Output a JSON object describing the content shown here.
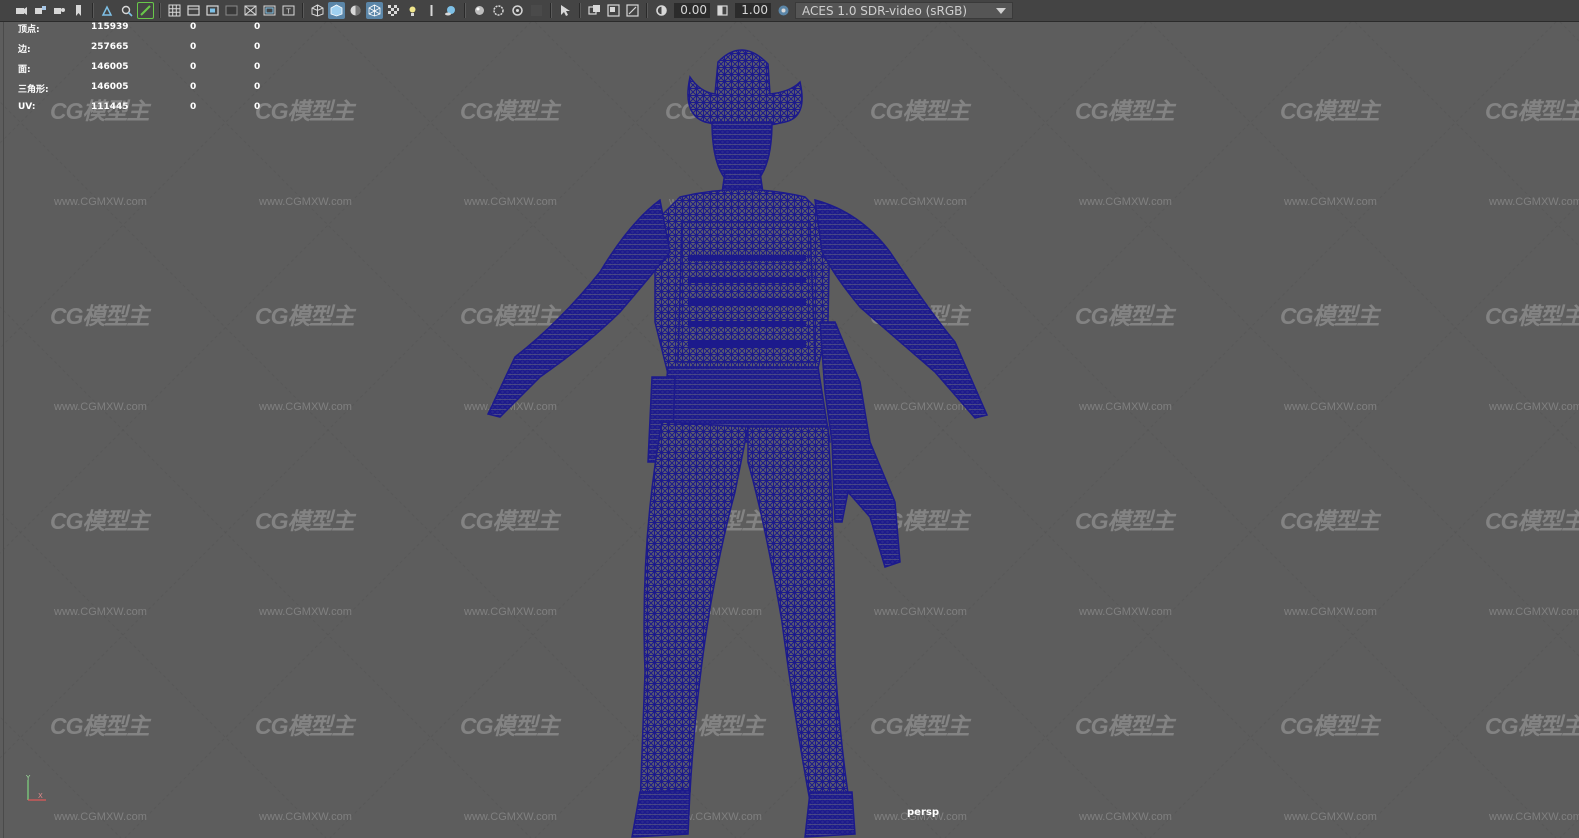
{
  "toolbar": {
    "exposure_value": "0.00",
    "gamma_value": "1.00",
    "color_space": "ACES 1.0 SDR-video (sRGB)",
    "accent_color": "#5b86a8",
    "active_outline_color": "#68c84a",
    "icons": [
      "camera-icon",
      "camera-attributes-icon",
      "bookmark-icon",
      "image-plane-icon",
      "grease-pencil-icon",
      "2d-pan-zoom-icon",
      "grease-pencil-active-icon",
      "grid-icon",
      "film-gate-icon",
      "resolution-gate-icon",
      "gate-mask-icon",
      "field-chart-icon",
      "safe-action-icon",
      "safe-title-icon",
      "wireframe-icon",
      "smooth-shade-icon",
      "default-material-icon",
      "wireframe-on-shaded-icon",
      "textured-icon",
      "lights-icon",
      "shadows-icon",
      "screen-space-ao-icon",
      "motion-blur-icon",
      "anti-aliasing-icon",
      "depth-of-field-icon",
      "isolate-select-icon",
      "xray-icon",
      "xray-joints-icon",
      "xray-components-icon",
      "exposure-icon",
      "gamma-icon",
      "view-transform-icon"
    ]
  },
  "hud": {
    "rows": [
      {
        "label": "顶点:",
        "value": "115939",
        "col2": "0",
        "col3": "0"
      },
      {
        "label": "边:",
        "value": "257665",
        "col2": "0",
        "col3": "0"
      },
      {
        "label": "面:",
        "value": "146005",
        "col2": "0",
        "col3": "0"
      },
      {
        "label": "三角形:",
        "value": "146005",
        "col2": "0",
        "col3": "0"
      },
      {
        "label": "UV:",
        "value": "111445",
        "col2": "0",
        "col3": "0"
      }
    ]
  },
  "viewport": {
    "camera_label": "persp",
    "background_color": "#5d5d5d",
    "wireframe_color": "#1c1a8c",
    "watermark_text": "CG模型主",
    "watermark_url": "www.CGMXW.com"
  }
}
